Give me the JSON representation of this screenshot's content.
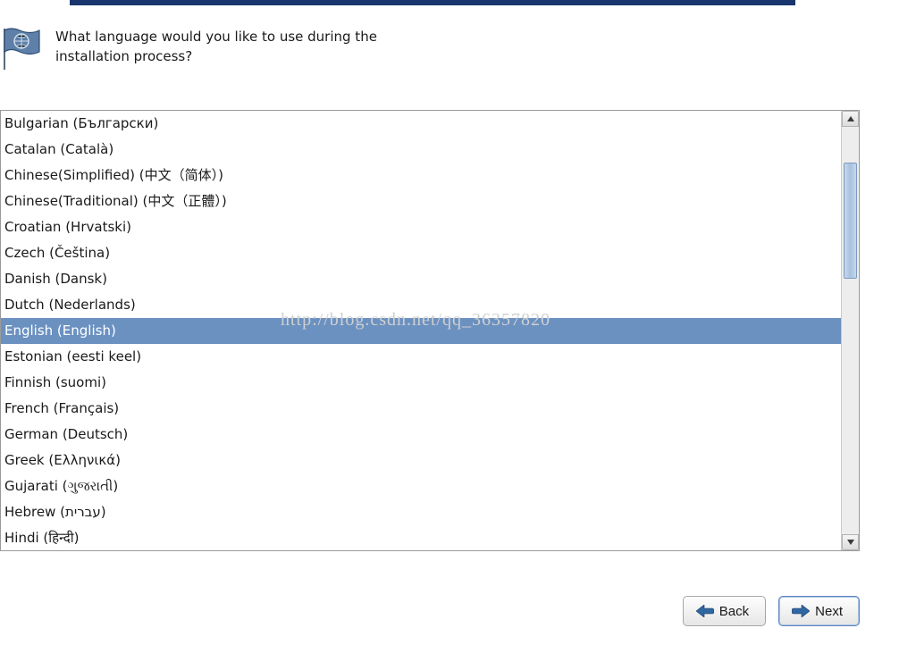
{
  "prompt": "What language would you like to use during the installation process?",
  "watermark": "http://blog.csdn.net/qq_36357820",
  "languages": [
    "Bulgarian (Български)",
    "Catalan (Català)",
    "Chinese(Simplified) (中文（简体）)",
    "Chinese(Traditional) (中文（正體）)",
    "Croatian (Hrvatski)",
    "Czech (Čeština)",
    "Danish (Dansk)",
    "Dutch (Nederlands)",
    "English (English)",
    "Estonian (eesti keel)",
    "Finnish (suomi)",
    "French (Français)",
    "German (Deutsch)",
    "Greek (Ελληνικά)",
    "Gujarati (ગુજરાતી)",
    "Hebrew (עברית)",
    "Hindi (हिन्दी)"
  ],
  "selected_index": 8,
  "buttons": {
    "back": "Back",
    "next": "Next"
  }
}
